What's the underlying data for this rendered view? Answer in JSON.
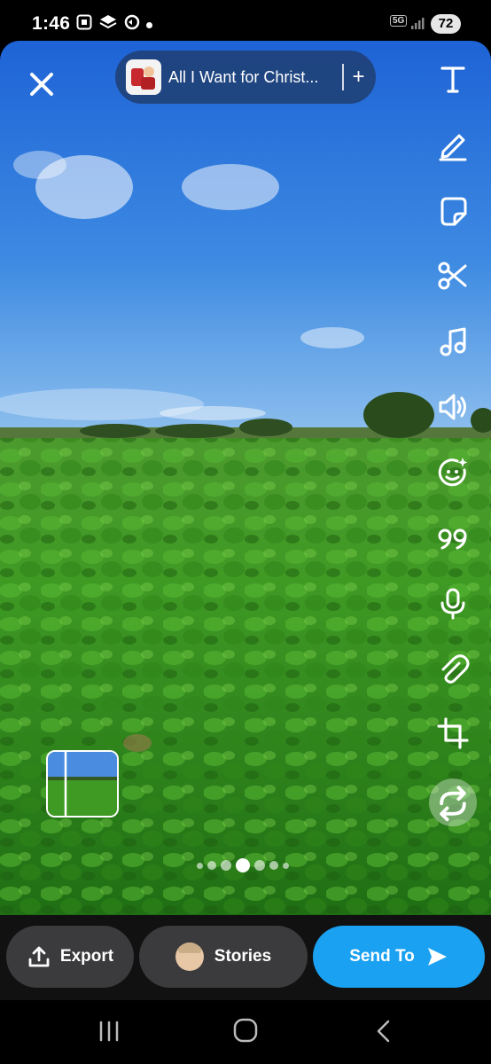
{
  "status_bar": {
    "time": "1:46",
    "network": "5G",
    "battery": "72"
  },
  "top": {
    "song_title": "All I Want for Christ...",
    "add_label": "+"
  },
  "toolbar": {
    "tools": [
      "text-icon",
      "pen-icon",
      "sticker-icon",
      "scissors-icon",
      "music-icon",
      "speaker-icon",
      "lens-icon",
      "quote-icon",
      "mic-icon",
      "paperclip-icon",
      "crop-icon",
      "loop-icon"
    ]
  },
  "bottom": {
    "export_label": "Export",
    "stories_label": "Stories",
    "send_label": "Send To"
  },
  "colors": {
    "send_button": "#1aa1f1",
    "pill_bg": "#3b3b3d",
    "bar_bg": "#111111"
  }
}
